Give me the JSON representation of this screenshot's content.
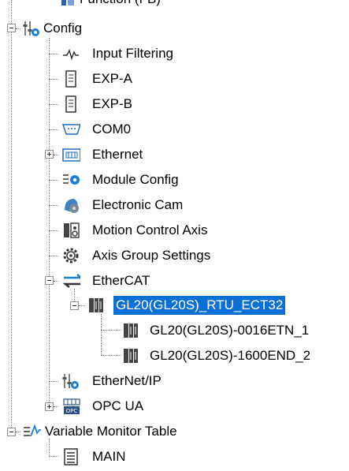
{
  "tree": {
    "cut_item": "Function (FB)",
    "config": {
      "label": "Config",
      "children": [
        {
          "label": "Input Filtering",
          "icon": "waveform-icon"
        },
        {
          "label": "EXP-A",
          "icon": "module-icon"
        },
        {
          "label": "EXP-B",
          "icon": "module-icon"
        },
        {
          "label": "COM0",
          "icon": "serial-port-icon"
        },
        {
          "label": "Ethernet",
          "icon": "network-icon"
        },
        {
          "label": "Module Config",
          "icon": "module-config-icon"
        },
        {
          "label": "Electronic Cam",
          "icon": "cam-icon"
        },
        {
          "label": "Motion Control Axis",
          "icon": "axis-icon"
        },
        {
          "label": "Axis Group Settings",
          "icon": "gear-icon"
        },
        {
          "label": "EtherCAT",
          "icon": "ethercat-icon"
        }
      ],
      "ethercat": {
        "rtu": "GL20(GL20S)_RTU_ECT32",
        "modules": [
          "GL20(GL20S)-0016ETN_1",
          "GL20(GL20S)-1600END_2"
        ]
      },
      "ethernet_ip": "EtherNet/IP",
      "opc_ua": "OPC UA",
      "opc_badge": "OPC"
    },
    "monitor": {
      "label": "Variable Monitor Table",
      "child": "MAIN"
    }
  },
  "colors": {
    "selection": "#0a6fd6",
    "accent": "#1a7fd9"
  }
}
